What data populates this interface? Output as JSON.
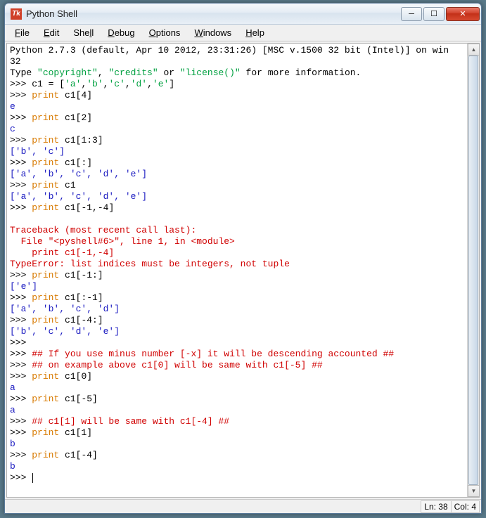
{
  "window": {
    "title": "Python Shell",
    "icon_text": "Tk"
  },
  "win_controls": {
    "minimize": "─",
    "maximize": "☐",
    "close": "✕"
  },
  "menu": {
    "file": "File",
    "edit": "Edit",
    "shell": "Shell",
    "debug": "Debug",
    "options": "Options",
    "windows": "Windows",
    "help": "Help"
  },
  "banner": {
    "line1": "Python 2.7.3 (default, Apr 10 2012, 23:31:26) [MSC v.1500 32 bit (Intel)] on win",
    "line2": "32",
    "line3_a": "Type ",
    "line3_b": "\"copyright\"",
    "line3_c": ", ",
    "line3_d": "\"credits\"",
    "line3_e": " or ",
    "line3_f": "\"license()\"",
    "line3_g": " for more information."
  },
  "prompt": ">>> ",
  "stmt1": {
    "pre": "c1 = [",
    "a": "'a'",
    "c1": ",",
    "b": "'b'",
    "c2": ",",
    "c": "'c'",
    "c3": ",",
    "d": "'d'",
    "c4": ",",
    "e": "'e'",
    "post": "]"
  },
  "stmt2": {
    "kw": "print",
    "rest": " c1[4]"
  },
  "out2": "e",
  "stmt3": {
    "kw": "print",
    "rest": " c1[2]"
  },
  "out3": "c",
  "stmt4": {
    "kw": "print",
    "rest": " c1[1:3]"
  },
  "out4": "['b', 'c']",
  "stmt5": {
    "kw": "print",
    "rest": " c1[:]"
  },
  "out5": "['a', 'b', 'c', 'd', 'e']",
  "stmt6": {
    "kw": "print",
    "rest": " c1"
  },
  "out6": "['a', 'b', 'c', 'd', 'e']",
  "stmt7": {
    "kw": "print",
    "rest": " c1[-1,-4]"
  },
  "blank": "",
  "tb1": "Traceback (most recent call last):",
  "tb2": "  File \"<pyshell#6>\", line 1, in <module>",
  "tb3": "    print c1[-1,-4]",
  "tb4": "TypeError: list indices must be integers, not tuple",
  "stmt8": {
    "kw": "print",
    "rest": " c1[-1:]"
  },
  "out8": "['e']",
  "stmt9": {
    "kw": "print",
    "rest": " c1[:-1]"
  },
  "out9": "['a', 'b', 'c', 'd']",
  "stmt10": {
    "kw": "print",
    "rest": " c1[-4:]"
  },
  "out10": "['b', 'c', 'd', 'e']",
  "cmt1": "## If you use minus number [-x] it will be descending accounted ##",
  "cmt2": "## on example above c1[0] will be same with c1[-5] ##",
  "stmt11": {
    "kw": "print",
    "rest": " c1[0]"
  },
  "out11": "a",
  "stmt12": {
    "kw": "print",
    "rest": " c1[-5]"
  },
  "out12": "a",
  "cmt3": "## c1[1] will be same with c1[-4] ##",
  "stmt13": {
    "kw": "print",
    "rest": " c1[1]"
  },
  "out13": "b",
  "stmt14": {
    "kw": "print",
    "rest": " c1[-4]"
  },
  "out14": "b",
  "status": {
    "ln": "Ln: 38",
    "col": "Col: 4"
  }
}
